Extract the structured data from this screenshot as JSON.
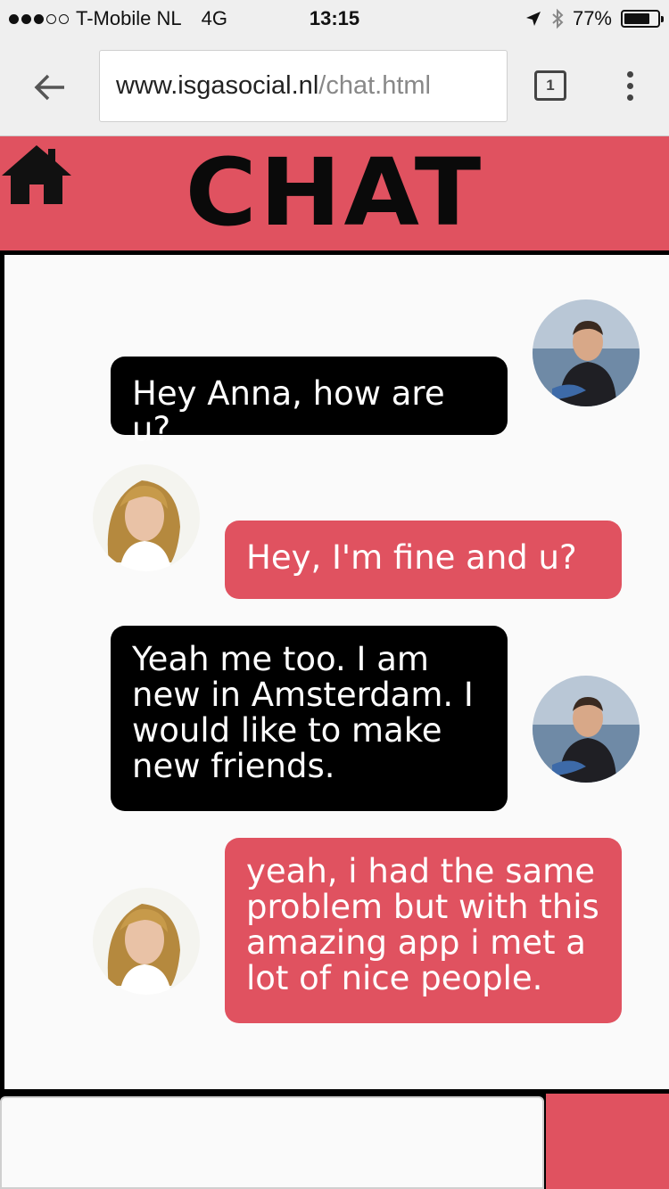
{
  "status_bar": {
    "carrier": "T-Mobile NL",
    "network": "4G",
    "time": "13:15",
    "battery_percent": "77%",
    "battery_level": 0.77,
    "signal_bars_filled": 3,
    "signal_bars_total": 5
  },
  "browser": {
    "url_host": "www.isgasocial.nl",
    "url_path": "/chat.html",
    "tab_count": "1"
  },
  "header": {
    "title": "CHAT"
  },
  "messages": [
    {
      "text": "Hey Anna, how are u?",
      "sender": "male-user",
      "style": "dark"
    },
    {
      "text": "Hey, I'm fine and u?",
      "sender": "anna",
      "style": "red"
    },
    {
      "text": "Yeah me too. I am new in Amsterdam. I would like to make new friends.",
      "sender": "male-user",
      "style": "dark"
    },
    {
      "text": "yeah, i had the same problem but with this amazing app i met a lot of nice people.",
      "sender": "anna",
      "style": "red"
    }
  ],
  "colors": {
    "brand_red": "#e05260",
    "dark_bubble": "#000000"
  }
}
